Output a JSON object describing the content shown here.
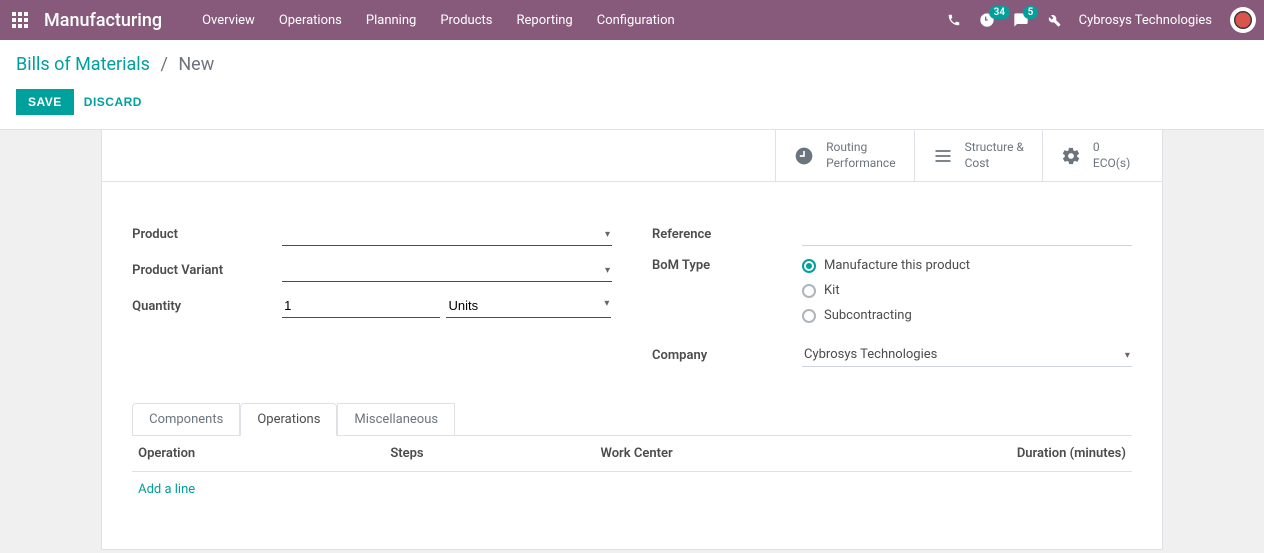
{
  "topnav": {
    "app_title": "Manufacturing",
    "menu": [
      "Overview",
      "Operations",
      "Planning",
      "Products",
      "Reporting",
      "Configuration"
    ],
    "activity_badge": "34",
    "msg_badge": "5",
    "company": "Cybrosys Technologies"
  },
  "breadcrumb": {
    "root": "Bills of Materials",
    "current": "New"
  },
  "buttons": {
    "save": "SAVE",
    "discard": "DISCARD"
  },
  "stats": {
    "routing_l1": "Routing",
    "routing_l2": "Performance",
    "struct_l1": "Structure &",
    "struct_l2": "Cost",
    "eco_l1": "0",
    "eco_l2": "ECO(s)"
  },
  "fields": {
    "product_label": "Product",
    "product_value": "",
    "variant_label": "Product Variant",
    "variant_value": "",
    "quantity_label": "Quantity",
    "quantity_value": "1",
    "quantity_unit": "Units",
    "reference_label": "Reference",
    "reference_value": "",
    "bom_type_label": "BoM Type",
    "bom_opts": {
      "manufacture": "Manufacture this product",
      "kit": "Kit",
      "sub": "Subcontracting"
    },
    "company_label": "Company",
    "company_value": "Cybrosys Technologies"
  },
  "tabs": {
    "components": "Components",
    "operations": "Operations",
    "misc": "Miscellaneous"
  },
  "grid": {
    "operation": "Operation",
    "steps": "Steps",
    "work_center": "Work Center",
    "duration": "Duration (minutes)",
    "add_line": "Add a line"
  }
}
